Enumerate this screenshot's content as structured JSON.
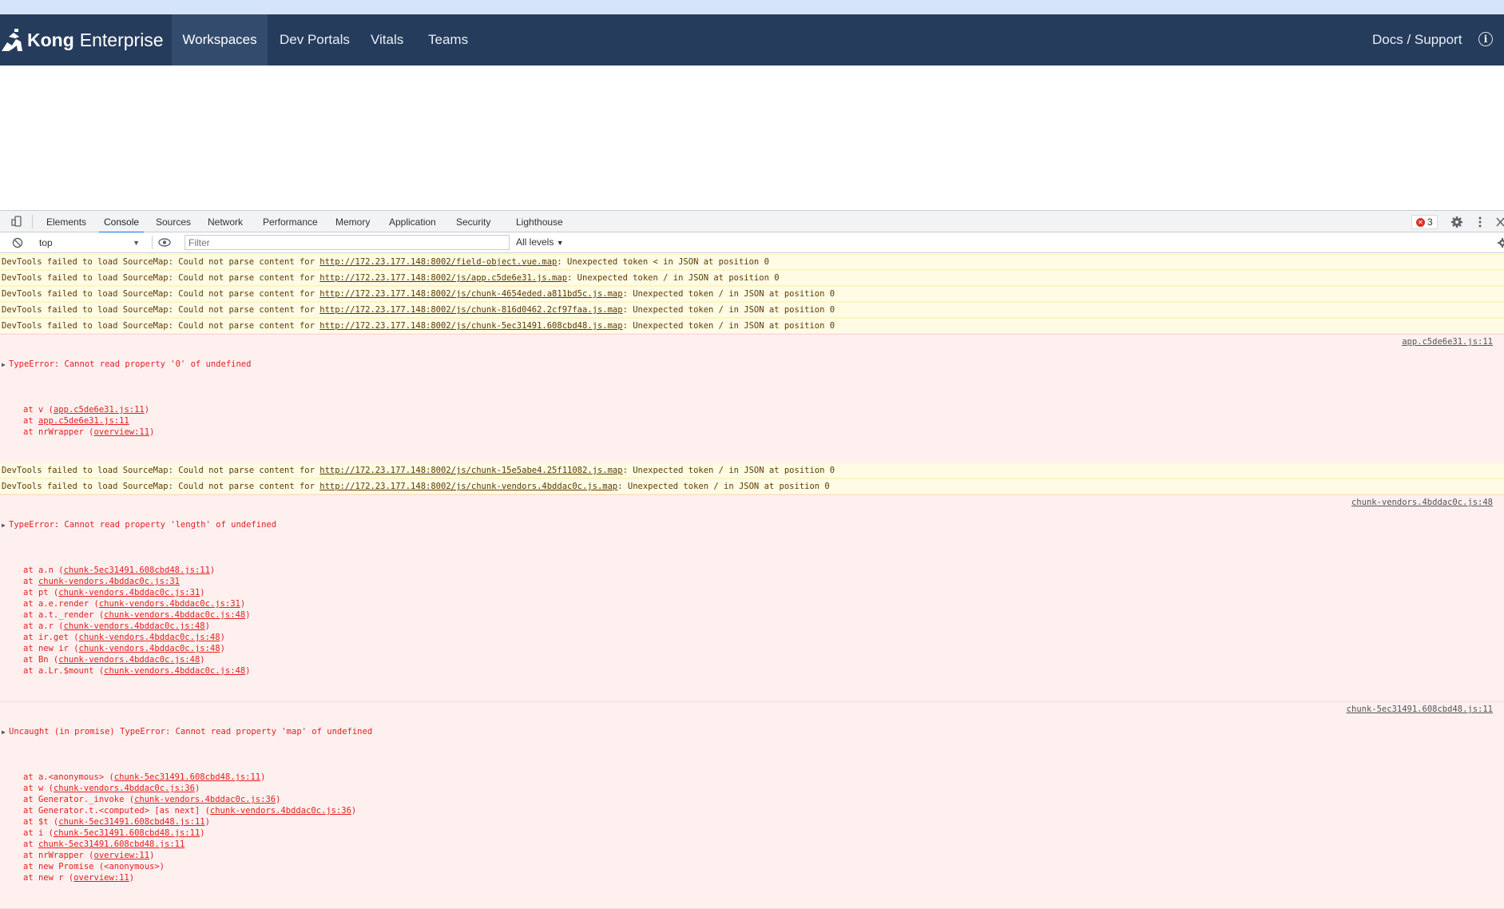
{
  "app": {
    "brand_bold": "Kong",
    "brand_light": "Enterprise",
    "nav": [
      "Workspaces",
      "Dev Portals",
      "Vitals",
      "Teams"
    ],
    "active_nav": "Workspaces",
    "docs_link": "Docs / Support",
    "info_glyph": "i"
  },
  "devtools": {
    "tabs": [
      "Elements",
      "Console",
      "Sources",
      "Network",
      "Performance",
      "Memory",
      "Application",
      "Security",
      "Lighthouse"
    ],
    "active_tab": "Console",
    "error_count": "3",
    "context": "top",
    "filter_placeholder": "Filter",
    "levels": "All levels"
  },
  "console": {
    "warn_prefix": "DevTools failed to load SourceMap: Could not parse content for ",
    "warnings_a": [
      {
        "url": "http://172.23.177.148:8002/field-object.vue.map",
        "tail": ": Unexpected token < in JSON at position 0"
      },
      {
        "url": "http://172.23.177.148:8002/js/app.c5de6e31.js.map",
        "tail": ": Unexpected token / in JSON at position 0"
      },
      {
        "url": "http://172.23.177.148:8002/js/chunk-4654eded.a811bd5c.js.map",
        "tail": ": Unexpected token / in JSON at position 0"
      },
      {
        "url": "http://172.23.177.148:8002/js/chunk-816d0462.2cf97faa.js.map",
        "tail": ": Unexpected token / in JSON at position 0"
      },
      {
        "url": "http://172.23.177.148:8002/js/chunk-5ec31491.608cbd48.js.map",
        "tail": ": Unexpected token / in JSON at position 0"
      }
    ],
    "error1": {
      "message": "TypeError: Cannot read property '0' of undefined",
      "source": "app.c5de6e31.js:11",
      "stack": [
        {
          "pre": "at v (",
          "link": "app.c5de6e31.js:11",
          "post": ")"
        },
        {
          "pre": "at ",
          "link": "app.c5de6e31.js:11",
          "post": ""
        },
        {
          "pre": "at nrWrapper (",
          "link": "overview:11",
          "post": ")"
        }
      ]
    },
    "warnings_b": [
      {
        "url": "http://172.23.177.148:8002/js/chunk-15e5abe4.25f11082.js.map",
        "tail": ": Unexpected token / in JSON at position 0"
      },
      {
        "url": "http://172.23.177.148:8002/js/chunk-vendors.4bddac0c.js.map",
        "tail": ": Unexpected token / in JSON at position 0"
      }
    ],
    "error2": {
      "message": "TypeError: Cannot read property 'length' of undefined",
      "source": "chunk-vendors.4bddac0c.js:48",
      "stack": [
        {
          "pre": "at a.n (",
          "link": "chunk-5ec31491.608cbd48.js:11",
          "post": ")"
        },
        {
          "pre": "at ",
          "link": "chunk-vendors.4bddac0c.js:31",
          "post": ""
        },
        {
          "pre": "at pt (",
          "link": "chunk-vendors.4bddac0c.js:31",
          "post": ")"
        },
        {
          "pre": "at a.e.render (",
          "link": "chunk-vendors.4bddac0c.js:31",
          "post": ")"
        },
        {
          "pre": "at a.t._render (",
          "link": "chunk-vendors.4bddac0c.js:48",
          "post": ")"
        },
        {
          "pre": "at a.r (",
          "link": "chunk-vendors.4bddac0c.js:48",
          "post": ")"
        },
        {
          "pre": "at ir.get (",
          "link": "chunk-vendors.4bddac0c.js:48",
          "post": ")"
        },
        {
          "pre": "at new ir (",
          "link": "chunk-vendors.4bddac0c.js:48",
          "post": ")"
        },
        {
          "pre": "at Bn (",
          "link": "chunk-vendors.4bddac0c.js:48",
          "post": ")"
        },
        {
          "pre": "at a.Lr.$mount (",
          "link": "chunk-vendors.4bddac0c.js:48",
          "post": ")"
        }
      ]
    },
    "error3": {
      "message": "Uncaught (in promise) TypeError: Cannot read property 'map' of undefined",
      "source": "chunk-5ec31491.608cbd48.js:11",
      "stack": [
        {
          "pre": "at a.<anonymous> (",
          "link": "chunk-5ec31491.608cbd48.js:11",
          "post": ")"
        },
        {
          "pre": "at w (",
          "link": "chunk-vendors.4bddac0c.js:36",
          "post": ")"
        },
        {
          "pre": "at Generator._invoke (",
          "link": "chunk-vendors.4bddac0c.js:36",
          "post": ")"
        },
        {
          "pre": "at Generator.t.<computed> [as next] (",
          "link": "chunk-vendors.4bddac0c.js:36",
          "post": ")"
        },
        {
          "pre": "at $t (",
          "link": "chunk-5ec31491.608cbd48.js:11",
          "post": ")"
        },
        {
          "pre": "at i (",
          "link": "chunk-5ec31491.608cbd48.js:11",
          "post": ")"
        },
        {
          "pre": "at ",
          "link": "chunk-5ec31491.608cbd48.js:11",
          "post": ""
        },
        {
          "pre": "at nrWrapper (",
          "link": "overview:11",
          "post": ")"
        },
        {
          "pre": "at new Promise (<anonymous>)",
          "link": "",
          "post": ""
        },
        {
          "pre": "at new r (",
          "link": "overview:11",
          "post": ")"
        }
      ]
    }
  }
}
